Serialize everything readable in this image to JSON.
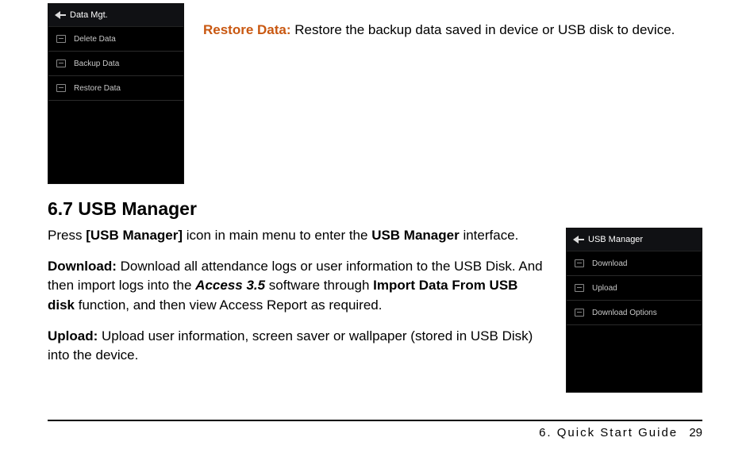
{
  "device1": {
    "title": "Data Mgt.",
    "items": [
      "Delete Data",
      "Backup Data",
      "Restore Data"
    ]
  },
  "restore": {
    "label": "Restore Data:",
    "text": " Restore the backup data saved in device or USB disk to device."
  },
  "section_heading": "6.7 USB Manager",
  "p1": {
    "a": "Press ",
    "b": "[USB Manager]",
    "c": " icon in main menu to enter the ",
    "d": "USB Manager",
    "e": " interface."
  },
  "p2": {
    "a": "Download:",
    "b": " Download all attendance logs or user information to the USB Disk. And then import logs into the ",
    "c": "Access 3.5",
    "d": " software through ",
    "e": "Import Data From USB disk",
    "f": " function, and then view Access Report as required."
  },
  "p3": {
    "a": "Upload:",
    "b": " Upload user information, screen saver or wallpaper (stored in USB Disk) into the device."
  },
  "device2": {
    "title": "USB Manager",
    "items": [
      "Download",
      "Upload",
      "Download Options"
    ]
  },
  "footer": {
    "chapter": "6.  Quick  Start  Guide",
    "page": "29"
  }
}
